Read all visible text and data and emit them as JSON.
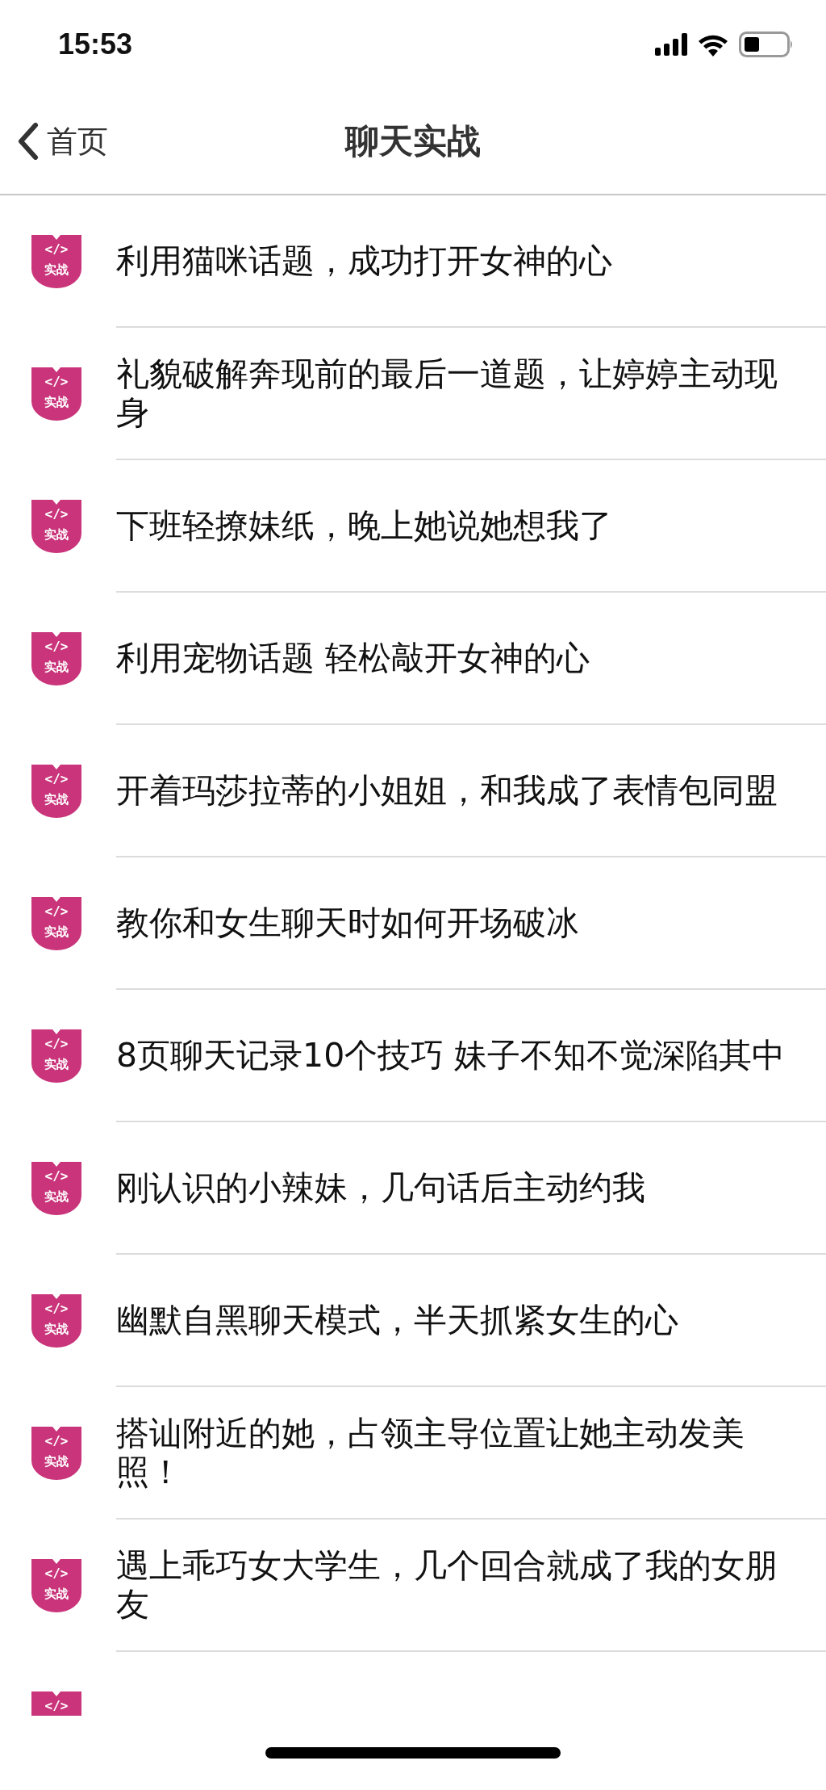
{
  "status_bar": {
    "time": "15:53"
  },
  "nav": {
    "back_label": "首页",
    "title": "聊天实战"
  },
  "items": [
    {
      "badge": {
        "symbol": "</>",
        "label": "实战"
      },
      "title": "利用猫咪话题，成功打开女神的心"
    },
    {
      "badge": {
        "symbol": "</>",
        "label": "实战"
      },
      "title": "礼貌破解奔现前的最后一道题，让婷婷主动现身"
    },
    {
      "badge": {
        "symbol": "</>",
        "label": "实战"
      },
      "title": "下班轻撩妹纸，晚上她说她想我了"
    },
    {
      "badge": {
        "symbol": "</>",
        "label": "实战"
      },
      "title": "利用宠物话题 轻松敲开女神的心"
    },
    {
      "badge": {
        "symbol": "</>",
        "label": "实战"
      },
      "title": "开着玛莎拉蒂的小姐姐，和我成了表情包同盟"
    },
    {
      "badge": {
        "symbol": "</>",
        "label": "实战"
      },
      "title": "教你和女生聊天时如何开场破冰"
    },
    {
      "badge": {
        "symbol": "</>",
        "label": "实战"
      },
      "title": "8页聊天记录10个技巧 妹子不知不觉深陷其中"
    },
    {
      "badge": {
        "symbol": "</>",
        "label": "实战"
      },
      "title": "刚认识的小辣妹，几句话后主动约我"
    },
    {
      "badge": {
        "symbol": "</>",
        "label": "实战"
      },
      "title": "幽默自黑聊天模式，半天抓紧女生的心"
    },
    {
      "badge": {
        "symbol": "</>",
        "label": "实战"
      },
      "title": "搭讪附近的她，占领主导位置让她主动发美照！"
    },
    {
      "badge": {
        "symbol": "</>",
        "label": "实战"
      },
      "title": "遇上乖巧女大学生，几个回合就成了我的女朋友"
    },
    {
      "badge": {
        "symbol": "</>"
      }
    }
  ]
}
